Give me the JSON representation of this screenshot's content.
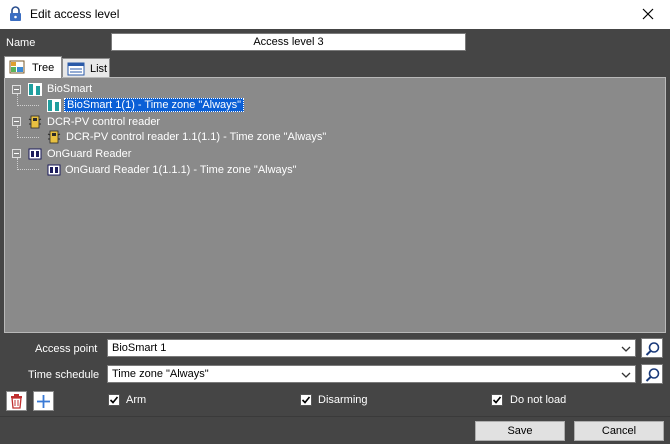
{
  "window": {
    "title": "Edit access level",
    "close_icon": "close-icon",
    "title_icon": "lock-icon"
  },
  "name_field": {
    "label": "Name",
    "value": "Access level 3"
  },
  "tabs": [
    {
      "label": "Tree",
      "icon": "tree-view-icon",
      "active": true
    },
    {
      "label": "List",
      "icon": "list-view-icon",
      "active": false
    }
  ],
  "tree": {
    "groups": [
      {
        "label": "BioSmart",
        "icon": "biosmart-icon",
        "children": [
          {
            "label": "BioSmart 1(1) - Time zone \"Always\"",
            "icon": "biosmart-icon",
            "selected": true
          }
        ]
      },
      {
        "label": "DCR-PV control reader",
        "icon": "reader-icon",
        "children": [
          {
            "label": "DCR-PV control reader 1.1(1.1) - Time zone \"Always\"",
            "icon": "reader-icon",
            "selected": false
          }
        ]
      },
      {
        "label": "OnGuard Reader",
        "icon": "onguard-reader-icon",
        "children": [
          {
            "label": "OnGuard Reader 1(1.1.1) - Time zone \"Always\"",
            "icon": "onguard-reader-icon",
            "selected": false
          }
        ]
      }
    ]
  },
  "access_point": {
    "label": "Access point",
    "value": "BioSmart 1"
  },
  "time_schedule": {
    "label": "Time schedule",
    "value": "Time zone \"Always\""
  },
  "checkboxes": [
    {
      "label": "Arm",
      "checked": true
    },
    {
      "label": "Disarming",
      "checked": true
    },
    {
      "label": "Do not load",
      "checked": true
    }
  ],
  "buttons": {
    "save": "Save",
    "cancel": "Cancel"
  },
  "colors": {
    "background": "#454545",
    "panel": "#8a8a8a",
    "selection": "#0a5fd6"
  }
}
